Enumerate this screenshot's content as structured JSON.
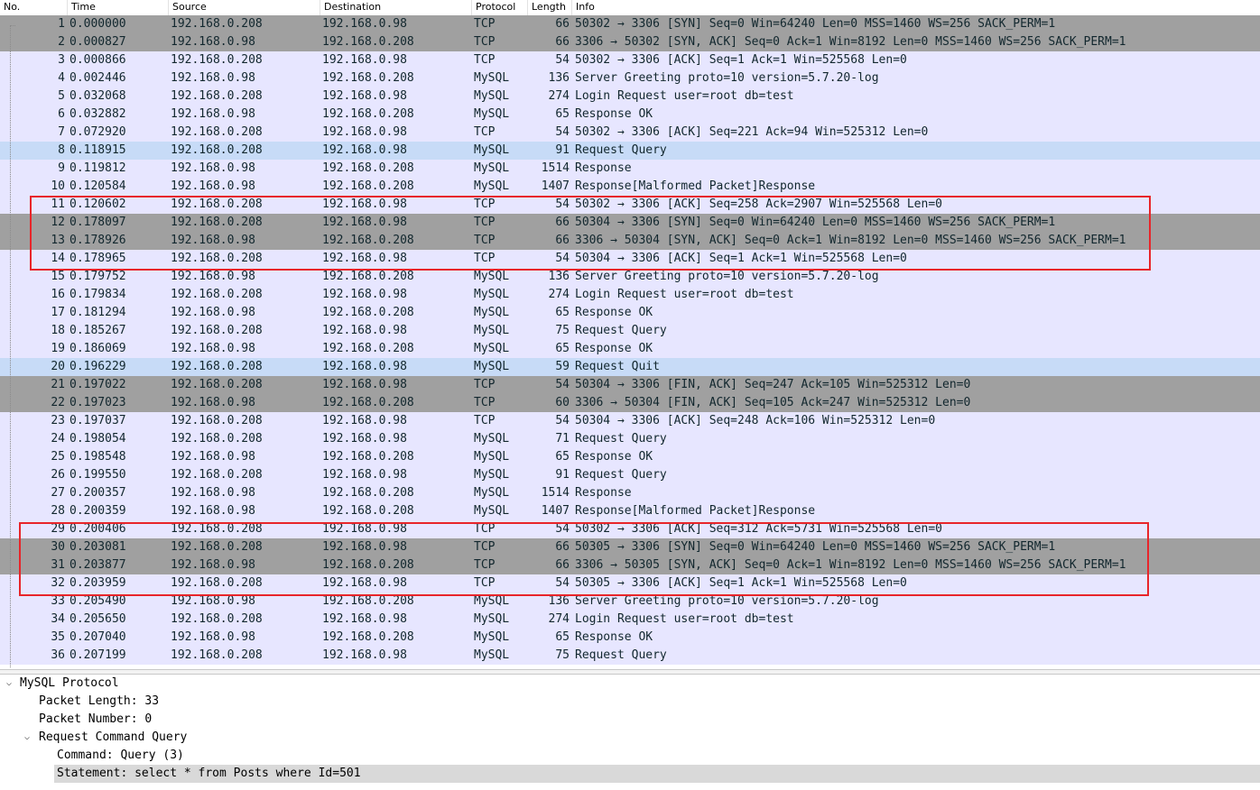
{
  "columns": {
    "no": "No.",
    "time": "Time",
    "source": "Source",
    "destination": "Destination",
    "protocol": "Protocol",
    "length": "Length",
    "info": "Info"
  },
  "packets": [
    {
      "no": "1",
      "time": "0.000000",
      "source": "192.168.0.208",
      "destination": "192.168.0.98",
      "protocol": "TCP",
      "length": "66",
      "info": "50302 → 3306 [SYN] Seq=0 Win=64240 Len=0 MSS=1460 WS=256 SACK_PERM=1",
      "style": "handshake"
    },
    {
      "no": "2",
      "time": "0.000827",
      "source": "192.168.0.98",
      "destination": "192.168.0.208",
      "protocol": "TCP",
      "length": "66",
      "info": "3306 → 50302 [SYN, ACK] Seq=0 Ack=1 Win=8192 Len=0 MSS=1460 WS=256 SACK_PERM=1",
      "style": "handshake"
    },
    {
      "no": "3",
      "time": "0.000866",
      "source": "192.168.0.208",
      "destination": "192.168.0.98",
      "protocol": "TCP",
      "length": "54",
      "info": "50302 → 3306 [ACK] Seq=1 Ack=1 Win=525568 Len=0",
      "style": "tcp"
    },
    {
      "no": "4",
      "time": "0.002446",
      "source": "192.168.0.98",
      "destination": "192.168.0.208",
      "protocol": "MySQL",
      "length": "136",
      "info": "Server Greeting proto=10 version=5.7.20-log",
      "style": "mysql"
    },
    {
      "no": "5",
      "time": "0.032068",
      "source": "192.168.0.208",
      "destination": "192.168.0.98",
      "protocol": "MySQL",
      "length": "274",
      "info": "Login Request user=root db=test",
      "style": "mysql"
    },
    {
      "no": "6",
      "time": "0.032882",
      "source": "192.168.0.98",
      "destination": "192.168.0.208",
      "protocol": "MySQL",
      "length": "65",
      "info": "Response OK",
      "style": "mysql"
    },
    {
      "no": "7",
      "time": "0.072920",
      "source": "192.168.0.208",
      "destination": "192.168.0.98",
      "protocol": "TCP",
      "length": "54",
      "info": "50302 → 3306 [ACK] Seq=221 Ack=94 Win=525312 Len=0",
      "style": "tcp"
    },
    {
      "no": "8",
      "time": "0.118915",
      "source": "192.168.0.208",
      "destination": "192.168.0.98",
      "protocol": "MySQL",
      "length": "91",
      "info": "Request Query",
      "style": "selected"
    },
    {
      "no": "9",
      "time": "0.119812",
      "source": "192.168.0.98",
      "destination": "192.168.0.208",
      "protocol": "MySQL",
      "length": "1514",
      "info": "Response",
      "style": "mysql"
    },
    {
      "no": "10",
      "time": "0.120584",
      "source": "192.168.0.98",
      "destination": "192.168.0.208",
      "protocol": "MySQL",
      "length": "1407",
      "info": "Response[Malformed Packet]Response",
      "style": "mysql"
    },
    {
      "no": "11",
      "time": "0.120602",
      "source": "192.168.0.208",
      "destination": "192.168.0.98",
      "protocol": "TCP",
      "length": "54",
      "info": "50302 → 3306 [ACK] Seq=258 Ack=2907 Win=525568 Len=0",
      "style": "tcp"
    },
    {
      "no": "12",
      "time": "0.178097",
      "source": "192.168.0.208",
      "destination": "192.168.0.98",
      "protocol": "TCP",
      "length": "66",
      "info": "50304 → 3306 [SYN] Seq=0 Win=64240 Len=0 MSS=1460 WS=256 SACK_PERM=1",
      "style": "handshake"
    },
    {
      "no": "13",
      "time": "0.178926",
      "source": "192.168.0.98",
      "destination": "192.168.0.208",
      "protocol": "TCP",
      "length": "66",
      "info": "3306 → 50304 [SYN, ACK] Seq=0 Ack=1 Win=8192 Len=0 MSS=1460 WS=256 SACK_PERM=1",
      "style": "handshake"
    },
    {
      "no": "14",
      "time": "0.178965",
      "source": "192.168.0.208",
      "destination": "192.168.0.98",
      "protocol": "TCP",
      "length": "54",
      "info": "50304 → 3306 [ACK] Seq=1 Ack=1 Win=525568 Len=0",
      "style": "tcp"
    },
    {
      "no": "15",
      "time": "0.179752",
      "source": "192.168.0.98",
      "destination": "192.168.0.208",
      "protocol": "MySQL",
      "length": "136",
      "info": "Server Greeting proto=10 version=5.7.20-log",
      "style": "mysql"
    },
    {
      "no": "16",
      "time": "0.179834",
      "source": "192.168.0.208",
      "destination": "192.168.0.98",
      "protocol": "MySQL",
      "length": "274",
      "info": "Login Request user=root db=test",
      "style": "mysql"
    },
    {
      "no": "17",
      "time": "0.181294",
      "source": "192.168.0.98",
      "destination": "192.168.0.208",
      "protocol": "MySQL",
      "length": "65",
      "info": "Response OK",
      "style": "mysql"
    },
    {
      "no": "18",
      "time": "0.185267",
      "source": "192.168.0.208",
      "destination": "192.168.0.98",
      "protocol": "MySQL",
      "length": "75",
      "info": "Request Query",
      "style": "mysql"
    },
    {
      "no": "19",
      "time": "0.186069",
      "source": "192.168.0.98",
      "destination": "192.168.0.208",
      "protocol": "MySQL",
      "length": "65",
      "info": "Response OK",
      "style": "mysql"
    },
    {
      "no": "20",
      "time": "0.196229",
      "source": "192.168.0.208",
      "destination": "192.168.0.98",
      "protocol": "MySQL",
      "length": "59",
      "info": "Request Quit",
      "style": "selected"
    },
    {
      "no": "21",
      "time": "0.197022",
      "source": "192.168.0.208",
      "destination": "192.168.0.98",
      "protocol": "TCP",
      "length": "54",
      "info": "50304 → 3306 [FIN, ACK] Seq=247 Ack=105 Win=525312 Len=0",
      "style": "handshake"
    },
    {
      "no": "22",
      "time": "0.197023",
      "source": "192.168.0.98",
      "destination": "192.168.0.208",
      "protocol": "TCP",
      "length": "60",
      "info": "3306 → 50304 [FIN, ACK] Seq=105 Ack=247 Win=525312 Len=0",
      "style": "handshake"
    },
    {
      "no": "23",
      "time": "0.197037",
      "source": "192.168.0.208",
      "destination": "192.168.0.98",
      "protocol": "TCP",
      "length": "54",
      "info": "50304 → 3306 [ACK] Seq=248 Ack=106 Win=525312 Len=0",
      "style": "tcp"
    },
    {
      "no": "24",
      "time": "0.198054",
      "source": "192.168.0.208",
      "destination": "192.168.0.98",
      "protocol": "MySQL",
      "length": "71",
      "info": "Request Query",
      "style": "mysql"
    },
    {
      "no": "25",
      "time": "0.198548",
      "source": "192.168.0.98",
      "destination": "192.168.0.208",
      "protocol": "MySQL",
      "length": "65",
      "info": "Response OK",
      "style": "mysql"
    },
    {
      "no": "26",
      "time": "0.199550",
      "source": "192.168.0.208",
      "destination": "192.168.0.98",
      "protocol": "MySQL",
      "length": "91",
      "info": "Request Query",
      "style": "mysql"
    },
    {
      "no": "27",
      "time": "0.200357",
      "source": "192.168.0.98",
      "destination": "192.168.0.208",
      "protocol": "MySQL",
      "length": "1514",
      "info": "Response",
      "style": "mysql"
    },
    {
      "no": "28",
      "time": "0.200359",
      "source": "192.168.0.98",
      "destination": "192.168.0.208",
      "protocol": "MySQL",
      "length": "1407",
      "info": "Response[Malformed Packet]Response",
      "style": "mysql"
    },
    {
      "no": "29",
      "time": "0.200406",
      "source": "192.168.0.208",
      "destination": "192.168.0.98",
      "protocol": "TCP",
      "length": "54",
      "info": "50302 → 3306 [ACK] Seq=312 Ack=5731 Win=525568 Len=0",
      "style": "tcp"
    },
    {
      "no": "30",
      "time": "0.203081",
      "source": "192.168.0.208",
      "destination": "192.168.0.98",
      "protocol": "TCP",
      "length": "66",
      "info": "50305 → 3306 [SYN] Seq=0 Win=64240 Len=0 MSS=1460 WS=256 SACK_PERM=1",
      "style": "handshake"
    },
    {
      "no": "31",
      "time": "0.203877",
      "source": "192.168.0.98",
      "destination": "192.168.0.208",
      "protocol": "TCP",
      "length": "66",
      "info": "3306 → 50305 [SYN, ACK] Seq=0 Ack=1 Win=8192 Len=0 MSS=1460 WS=256 SACK_PERM=1",
      "style": "handshake"
    },
    {
      "no": "32",
      "time": "0.203959",
      "source": "192.168.0.208",
      "destination": "192.168.0.98",
      "protocol": "TCP",
      "length": "54",
      "info": "50305 → 3306 [ACK] Seq=1 Ack=1 Win=525568 Len=0",
      "style": "tcp"
    },
    {
      "no": "33",
      "time": "0.205490",
      "source": "192.168.0.98",
      "destination": "192.168.0.208",
      "protocol": "MySQL",
      "length": "136",
      "info": "Server Greeting proto=10 version=5.7.20-log",
      "style": "mysql"
    },
    {
      "no": "34",
      "time": "0.205650",
      "source": "192.168.0.208",
      "destination": "192.168.0.98",
      "protocol": "MySQL",
      "length": "274",
      "info": "Login Request user=root db=test",
      "style": "mysql"
    },
    {
      "no": "35",
      "time": "0.207040",
      "source": "192.168.0.98",
      "destination": "192.168.0.208",
      "protocol": "MySQL",
      "length": "65",
      "info": "Response OK",
      "style": "mysql"
    },
    {
      "no": "36",
      "time": "0.207199",
      "source": "192.168.0.208",
      "destination": "192.168.0.98",
      "protocol": "MySQL",
      "length": "75",
      "info": "Request Query",
      "style": "mysql"
    }
  ],
  "details": {
    "protocol": "MySQL Protocol",
    "packet_length": "Packet Length: 33",
    "packet_number": "Packet Number: 0",
    "request_command": "Request Command Query",
    "command": "Command: Query (3)",
    "statement": "Statement: select * from Posts where Id=501"
  },
  "icons": {
    "expanded": "chevron-down-icon"
  },
  "colors": {
    "row_tcp": "#e7e6ff",
    "row_handshake": "#a0a0a0",
    "row_selected": "#c7dbf7",
    "highlight_box": "#e8252a"
  }
}
